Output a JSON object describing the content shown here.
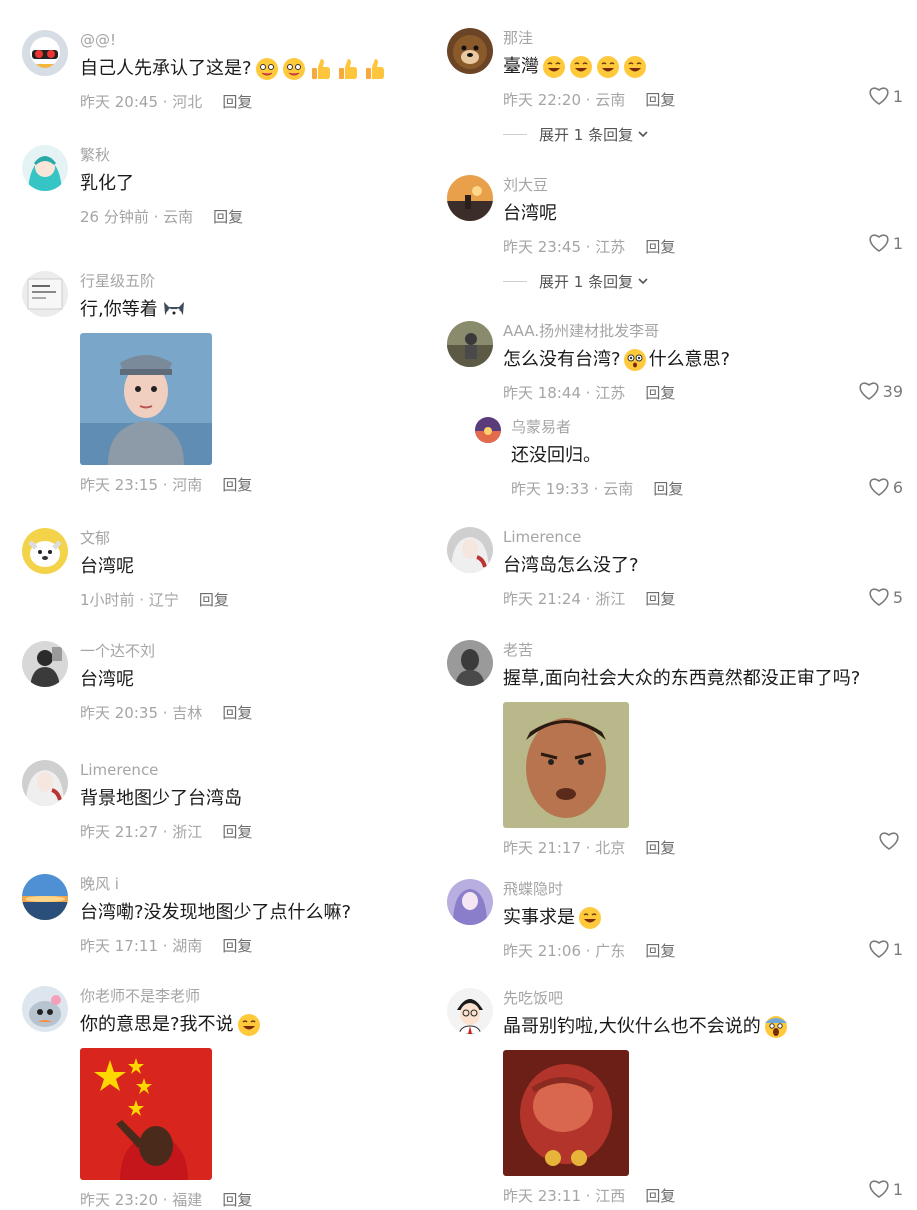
{
  "reply_label": "回复",
  "left": [
    {
      "username": "@@!",
      "text": "自己人先承认了这是?",
      "time": "昨天 20:45 · 河北",
      "emojis": [
        "grimace",
        "grimace",
        "thumb",
        "thumb",
        "thumb"
      ]
    },
    {
      "username": "繁秋",
      "text": "乳化了",
      "time": "26 分钟前 · 云南",
      "emojis": []
    },
    {
      "username": "行星级五阶",
      "text": "行,你等着",
      "time": "昨天 23:15 · 河南",
      "emojis": [
        "dog"
      ],
      "sticker": "soldier"
    },
    {
      "username": "文郁",
      "text": "台湾呢",
      "time": "1小时前 · 辽宁",
      "emojis": []
    },
    {
      "username": "一个达不刘",
      "text": "台湾呢",
      "time": "昨天 20:35 · 吉林",
      "emojis": []
    },
    {
      "username": "Limerence",
      "text": "背景地图少了台湾岛",
      "time": "昨天 21:27 · 浙江",
      "emojis": []
    },
    {
      "username": "晚风 i",
      "text": "台湾嘞?没发现地图少了点什么嘛?",
      "time": "昨天 17:11 · 湖南",
      "emojis": []
    },
    {
      "username": "你老师不是李老师",
      "text": "你的意思是?我不说",
      "time": "昨天 23:20 · 福建",
      "emojis": [
        "smile"
      ],
      "sticker": "flag"
    }
  ],
  "right": [
    {
      "username": "那洼",
      "text": "臺灣",
      "time": "昨天 22:20 · 云南",
      "emojis": [
        "smile",
        "smile",
        "smile",
        "smile"
      ],
      "likes": "1",
      "expand": "展开 1 条回复"
    },
    {
      "username": "刘大豆",
      "text": "台湾呢",
      "time": "昨天 23:45 · 江苏",
      "emojis": [],
      "likes": "1",
      "expand": "展开 1 条回复"
    },
    {
      "username": "AAA.扬州建材批发李哥",
      "text": "怎么没有台湾?",
      "text_after": "什么意思?",
      "time": "昨天 18:44 · 江苏",
      "emojis": [],
      "mid_emoji": "confused",
      "likes": "39",
      "reply": {
        "username": "乌蒙易者",
        "text": "还没回归。",
        "time": "昨天 19:33 · 云南",
        "likes": "6"
      }
    },
    {
      "username": "Limerence",
      "text": "台湾岛怎么没了?",
      "time": "昨天 21:24 · 浙江",
      "emojis": [],
      "likes": "5"
    },
    {
      "username": "老苦",
      "text": "握草,面向社会大众的东西竟然都没正审了吗?",
      "time": "昨天 21:17 · 北京",
      "emojis": [],
      "likes": "",
      "sticker": "face"
    },
    {
      "username": "飛蝶隐时",
      "text": "实事求是",
      "time": "昨天 21:06 · 广东",
      "emojis": [
        "smile"
      ],
      "likes": "1"
    },
    {
      "username": "先吃饭吧",
      "text": "晶哥别钓啦,大伙什么也不会说的",
      "time": "昨天 23:11 · 江西",
      "emojis": [
        "scream"
      ],
      "likes": "1",
      "sticker": "red"
    }
  ],
  "colors": {
    "text": "#1a1a1a",
    "meta": "#a5a5a5",
    "reply": "#6d6d6d"
  }
}
